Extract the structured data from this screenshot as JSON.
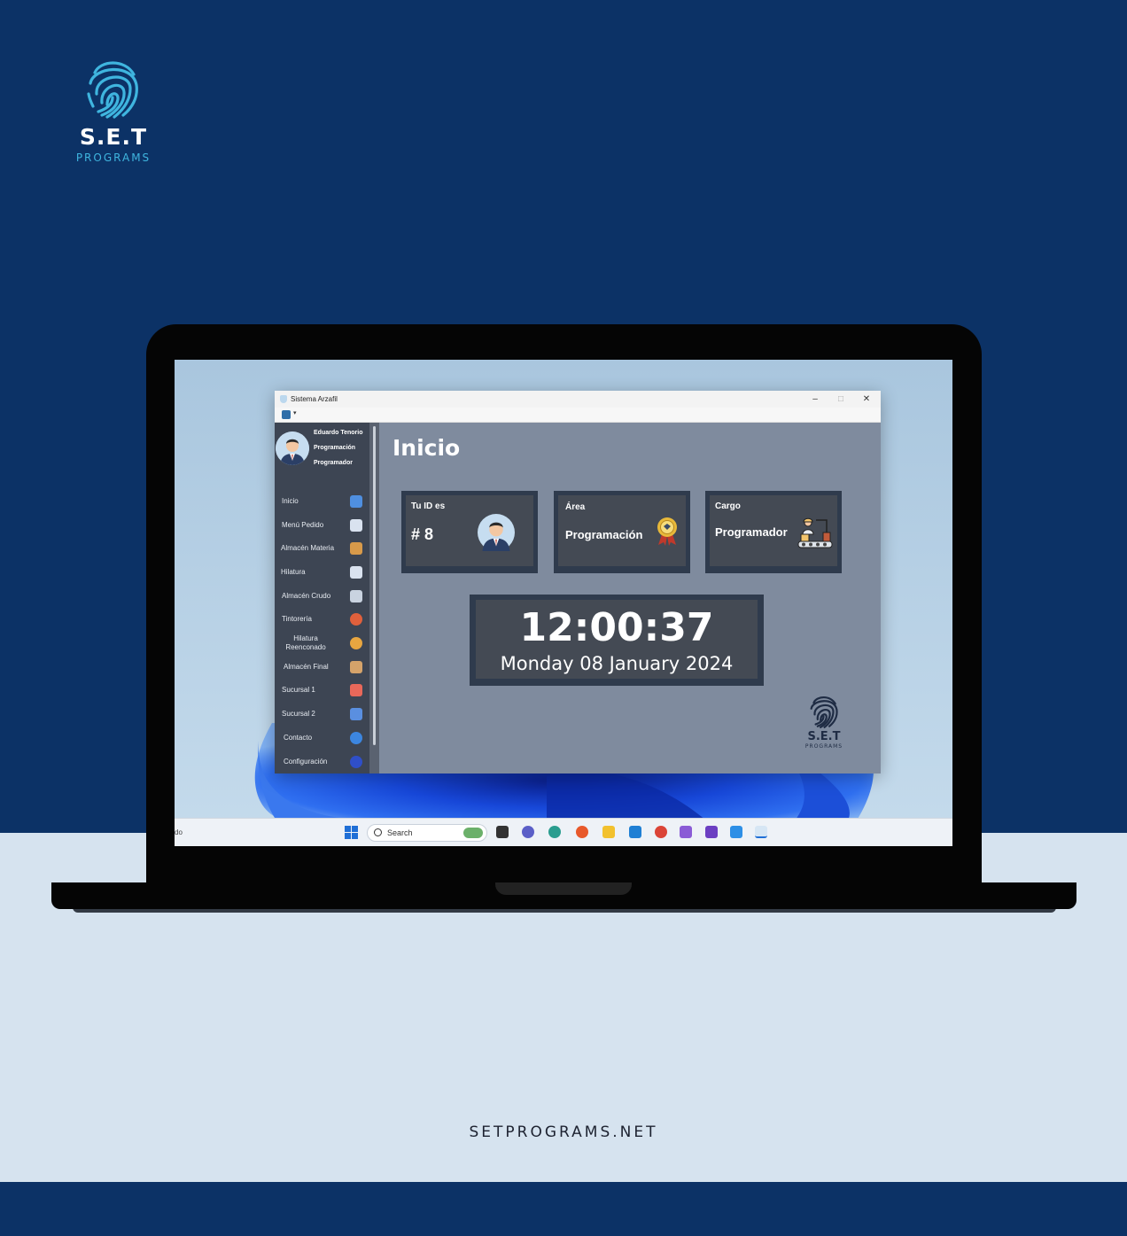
{
  "brand": {
    "name": "S.E.T",
    "sub": "PROGRAMS"
  },
  "footer": {
    "url": "SETPROGRAMS.NET"
  },
  "window": {
    "title": "Sistema Arzafil",
    "controls": {
      "minimize": "–",
      "maximize": "□",
      "close": "✕"
    }
  },
  "user": {
    "name": "Eduardo Tenorio",
    "area": "Programación",
    "role": "Programador"
  },
  "sidebar": {
    "items": [
      {
        "label": "Inicio",
        "icon": "home-icon",
        "color": "#4f8fe0"
      },
      {
        "label": "Menú Pedido",
        "icon": "clipboard-icon",
        "color": "#d9e2ef"
      },
      {
        "label": "Almacén Materia",
        "icon": "box-icon",
        "color": "#d89a4a"
      },
      {
        "label": "Hilatura",
        "icon": "spool-icon",
        "color": "#d9e2ef"
      },
      {
        "label": "Almacén Crudo",
        "icon": "warehouse-icon",
        "color": "#c9d3e0"
      },
      {
        "label": "Tintorería",
        "icon": "color-wheel-icon",
        "color": "#e0603c"
      },
      {
        "label": "Hilatura\nReenconado",
        "icon": "yarn-icon",
        "color": "#e8a640"
      },
      {
        "label": "Almacén Final",
        "icon": "package-icon",
        "color": "#d5a36a"
      },
      {
        "label": "Sucursal 1",
        "icon": "store-icon",
        "color": "#e8685a"
      },
      {
        "label": "Sucursal 2",
        "icon": "store-icon",
        "color": "#5a8fe0"
      },
      {
        "label": "Contacto",
        "icon": "contact-icon",
        "color": "#3c86e0"
      },
      {
        "label": "Configuración",
        "icon": "settings-icon",
        "color": "#2f4fc8"
      }
    ]
  },
  "main": {
    "title": "Inicio",
    "cards": {
      "id": {
        "label": "Tu ID es",
        "value": "# 8"
      },
      "area": {
        "label": "Área",
        "value": "Programación"
      },
      "role": {
        "label": "Cargo",
        "value": "Programador"
      }
    },
    "clock": {
      "time": "12:00:37",
      "date": "Monday 08 January 2024"
    },
    "logo": {
      "name": "S.E.T",
      "sub": "PROGRAMS"
    }
  },
  "taskbar": {
    "left_text": "do",
    "search_placeholder": "Search"
  },
  "colors": {
    "background": "#0c3266",
    "light_band": "#d6e3ef",
    "sidebar": "#3d4553",
    "main_panel": "#7f8b9e",
    "card_border": "#2f3b4d",
    "card_fill": "#444a54",
    "brand_accent": "#3fb5df"
  }
}
